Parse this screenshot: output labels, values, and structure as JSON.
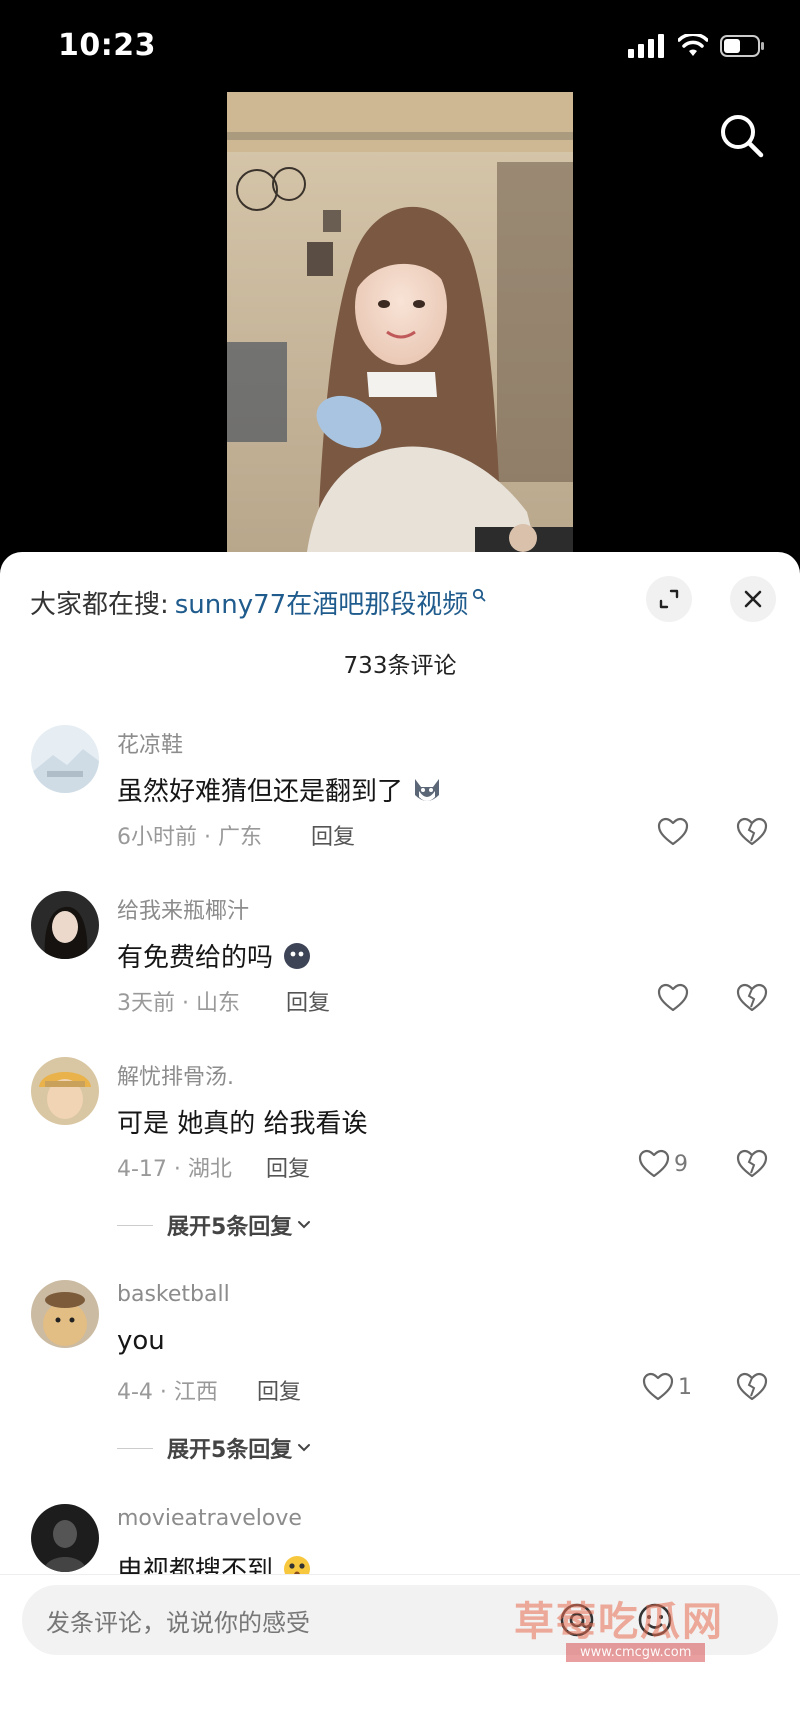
{
  "status_bar": {
    "time": "10:23"
  },
  "sheet": {
    "trend_prefix": "大家都在搜:",
    "trend_query": "sunny77在酒吧那段视频",
    "comment_count": "733条评论"
  },
  "comments": [
    {
      "user": "花凉鞋",
      "text": "虽然好难猜但还是翻到了",
      "meta": "6小时前 · 广东",
      "reply": "回复",
      "likes": ""
    },
    {
      "user": "给我来瓶椰汁",
      "text": "有免费给的吗",
      "meta": "3天前 · 山东",
      "reply": "回复",
      "likes": ""
    },
    {
      "user": "解忧排骨汤.",
      "text": "可是 她真的 给我看诶",
      "meta": "4-17 · 湖北",
      "reply": "回复",
      "likes": "9",
      "expand": "展开5条回复"
    },
    {
      "user": "basketball",
      "text": "you",
      "meta": "4-4 · 江西",
      "reply": "回复",
      "likes": "1",
      "expand": "展开5条回复"
    },
    {
      "user": "movieatravelove",
      "text": "电视都搜不到"
    }
  ],
  "input": {
    "placeholder": "发条评论，说说你的感受"
  },
  "watermark": {
    "text": "草莓吃瓜网",
    "url": "www.cmcgw.com"
  },
  "icons": {
    "search": "search-icon",
    "expand": "expand-icon",
    "close": "close-icon",
    "like": "heart-icon",
    "dislike": "broken-heart-icon",
    "mention": "at-icon",
    "emoji": "emoji-icon"
  },
  "colors": {
    "link": "#1f5b8c",
    "sheet_bg": "#ffffff",
    "page_bg": "#000000"
  }
}
